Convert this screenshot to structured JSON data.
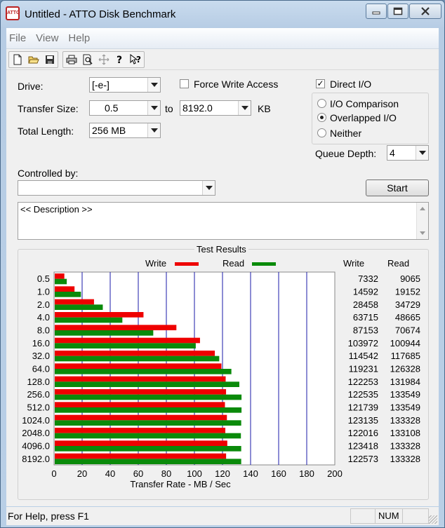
{
  "window": {
    "title": "Untitled - ATTO Disk Benchmark",
    "icon_text": "ATTO",
    "buttons": [
      "minimize",
      "maximize",
      "close"
    ]
  },
  "menu": [
    "File",
    "View",
    "Help"
  ],
  "toolbar": {
    "icons": [
      "new-icon",
      "open-icon",
      "save-icon",
      "print-icon",
      "print-preview-icon",
      "move-icon",
      "help-icon",
      "context-help-icon"
    ]
  },
  "form": {
    "drive_label": "Drive:",
    "drive_value": "[-e-]",
    "force_write_label": "Force Write Access",
    "force_write_checked": false,
    "direct_io_label": "Direct I/O",
    "direct_io_checked": true,
    "transfer_size_label": "Transfer Size:",
    "transfer_from": "0.5",
    "transfer_to_label": "to",
    "transfer_to": "8192.0",
    "transfer_unit": "KB",
    "total_length_label": "Total Length:",
    "total_length_value": "256 MB",
    "io_options": [
      {
        "label": "I/O Comparison",
        "selected": false
      },
      {
        "label": "Overlapped I/O",
        "selected": true
      },
      {
        "label": "Neither",
        "selected": false
      }
    ],
    "queue_depth_label": "Queue Depth:",
    "queue_depth_value": "4",
    "controlled_by_label": "Controlled by:",
    "controlled_by_value": "",
    "start_label": "Start",
    "description": "<< Description >>"
  },
  "results": {
    "title": "Test Results",
    "legend_write": "Write",
    "legend_read": "Read",
    "col_write": "Write",
    "col_read": "Read",
    "write_color": "#ee0000",
    "read_color": "#0a8a0a"
  },
  "chart_data": {
    "type": "bar",
    "orientation": "horizontal",
    "categories": [
      "0.5",
      "1.0",
      "2.0",
      "4.0",
      "8.0",
      "16.0",
      "32.0",
      "64.0",
      "128.0",
      "256.0",
      "512.0",
      "1024.0",
      "2048.0",
      "4096.0",
      "8192.0"
    ],
    "series": [
      {
        "name": "Write",
        "values": [
          7332,
          14592,
          28458,
          63715,
          87153,
          103972,
          114542,
          119231,
          122253,
          122535,
          121739,
          123135,
          122016,
          123418,
          122573
        ]
      },
      {
        "name": "Read",
        "values": [
          9065,
          19152,
          34729,
          48665,
          70674,
          100944,
          117685,
          126328,
          131984,
          133549,
          133549,
          133328,
          133108,
          133328,
          133328
        ]
      }
    ],
    "bar_scale_note": "bars plotted as value / 1000 on axis",
    "xticks": [
      "0",
      "20",
      "40",
      "60",
      "80",
      "100",
      "120",
      "140",
      "160",
      "180",
      "200"
    ],
    "xlim": [
      0,
      200
    ],
    "xlabel": "Transfer Rate - MB / Sec",
    "grid": true,
    "legend_position": "top"
  },
  "status": {
    "help_text": "For Help, press F1",
    "panes": [
      "",
      "NUM",
      ""
    ]
  }
}
